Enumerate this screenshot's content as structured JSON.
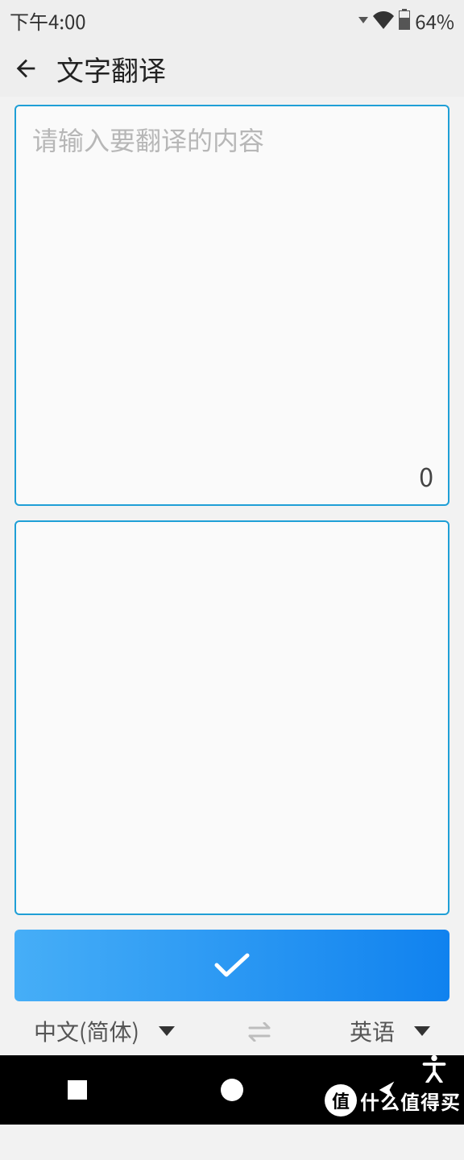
{
  "status": {
    "time": "下午4:00",
    "battery_percent": "64%"
  },
  "header": {
    "title": "文字翻译"
  },
  "input": {
    "placeholder": "请输入要翻译的内容",
    "value": "",
    "count": "0"
  },
  "output": {
    "value": ""
  },
  "languages": {
    "source": "中文(简体)",
    "target": "英语"
  },
  "watermark": {
    "badge": "值",
    "text": "什么值得买"
  },
  "colors": {
    "border": "#1f9fd6",
    "button_gradient_from": "#46aef7",
    "button_gradient_to": "#1082ef"
  }
}
